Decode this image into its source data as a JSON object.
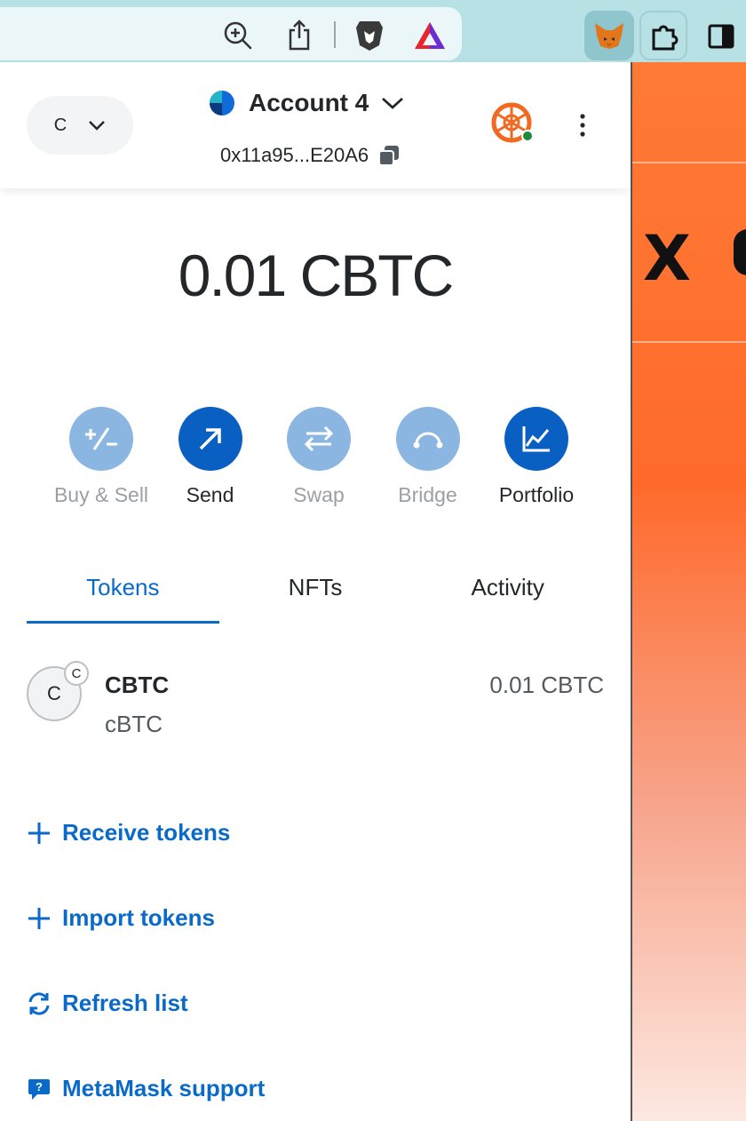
{
  "browser": {
    "toolbar_icons": [
      "zoom-in-icon",
      "share-icon",
      "brave-shield-icon",
      "brave-rewards-icon",
      "metamask-fox-icon",
      "extensions-puzzle-icon",
      "sidebar-toggle-icon"
    ]
  },
  "header": {
    "network_letter": "C",
    "account_name": "Account 4",
    "address": "0x11a95...E20A6"
  },
  "balance": {
    "amount": "0.01",
    "symbol": "CBTC"
  },
  "actions": [
    {
      "label": "Buy & Sell",
      "enabled": false
    },
    {
      "label": "Send",
      "enabled": true
    },
    {
      "label": "Swap",
      "enabled": false
    },
    {
      "label": "Bridge",
      "enabled": false
    },
    {
      "label": "Portfolio",
      "enabled": true
    }
  ],
  "tabs": [
    {
      "label": "Tokens",
      "active": true
    },
    {
      "label": "NFTs",
      "active": false
    },
    {
      "label": "Activity",
      "active": false
    }
  ],
  "tokens": [
    {
      "avatar_letter": "C",
      "badge_letter": "C",
      "symbol": "CBTC",
      "name": "cBTC",
      "balance": "0.01 CBTC"
    }
  ],
  "links": {
    "receive": "Receive tokens",
    "import": "Import tokens",
    "refresh": "Refresh list",
    "support": "MetaMask support"
  },
  "colors": {
    "primary": "#0a6ac9",
    "primary_button": "#0a5fc2",
    "disabled_button": "#8cb6e2",
    "site_background": "#ff7b35"
  }
}
